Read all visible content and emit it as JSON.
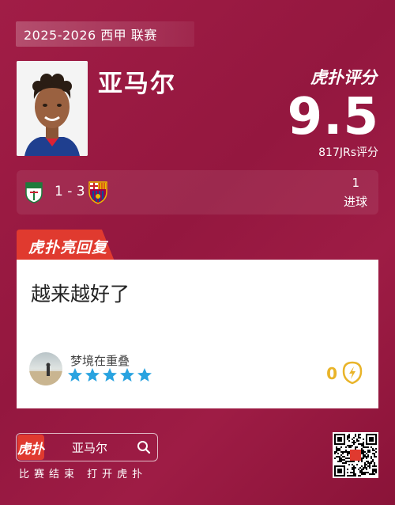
{
  "header": {
    "season": "2025-2026 西甲 联赛"
  },
  "player": {
    "name": "亚马尔"
  },
  "rating": {
    "brand": "虎扑评分",
    "score": "9.5",
    "count": "817JRs评分"
  },
  "match": {
    "score": "1 - 3",
    "goals_value": "1",
    "goals_label": "进球",
    "home_team_icon": "elche-crest-icon",
    "away_team_icon": "barcelona-crest-icon"
  },
  "reply": {
    "tab_label": "虎扑亮回复",
    "text": "越来越好了",
    "username": "梦境在重叠",
    "stars": 5,
    "likes": "0"
  },
  "footer": {
    "logo_text": "虎扑",
    "search_text": "亚马尔",
    "tagline": "比赛结束 打开虎扑"
  },
  "colors": {
    "background": "#9a1a43",
    "accent_red": "#e03a2f",
    "star_blue": "#29a3e0",
    "like_yellow": "#e9b429"
  }
}
